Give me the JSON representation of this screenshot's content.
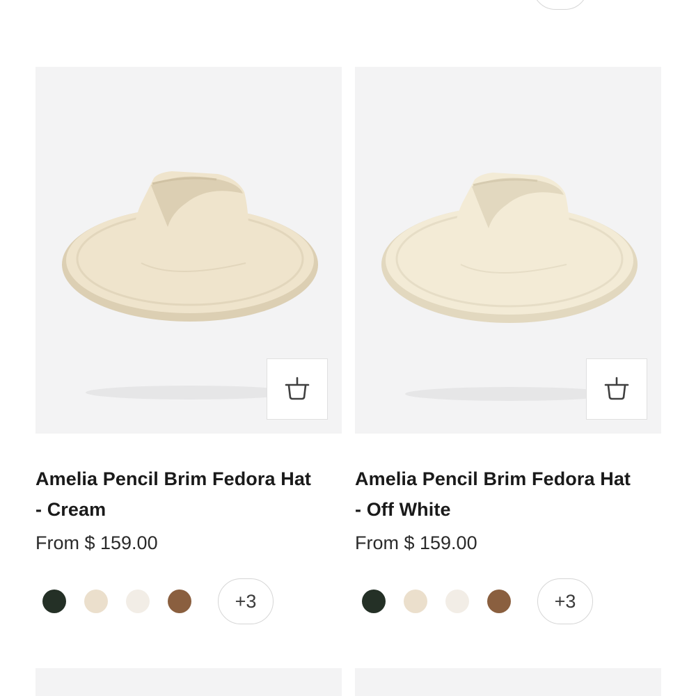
{
  "products": [
    {
      "title": "Amelia Pencil Brim Fedora Hat\n- Cream",
      "price": "From $ 159.00",
      "hat_color": "#efe4cc",
      "hat_shadow": "#dccfb3",
      "cart_icon": "basket-icon",
      "swatches": [
        {
          "name": "dark-green",
          "color": "#243026"
        },
        {
          "name": "cream",
          "color": "#ebdfcc"
        },
        {
          "name": "off-white",
          "color": "#f2ede6"
        },
        {
          "name": "brown",
          "color": "#8a5f3f"
        }
      ],
      "more_label": "+3"
    },
    {
      "title": "Amelia Pencil Brim Fedora Hat\n- Off White",
      "price": "From $ 159.00",
      "hat_color": "#f3ebd6",
      "hat_shadow": "#e2d8bf",
      "cart_icon": "basket-icon",
      "swatches": [
        {
          "name": "dark-green",
          "color": "#243026"
        },
        {
          "name": "cream",
          "color": "#ebdfcc"
        },
        {
          "name": "off-white",
          "color": "#f2ede6"
        },
        {
          "name": "brown",
          "color": "#8a5f3f"
        }
      ],
      "more_label": "+3"
    }
  ],
  "colors": {
    "image_bg": "#f3f3f4",
    "border": "#d6d6d6"
  }
}
